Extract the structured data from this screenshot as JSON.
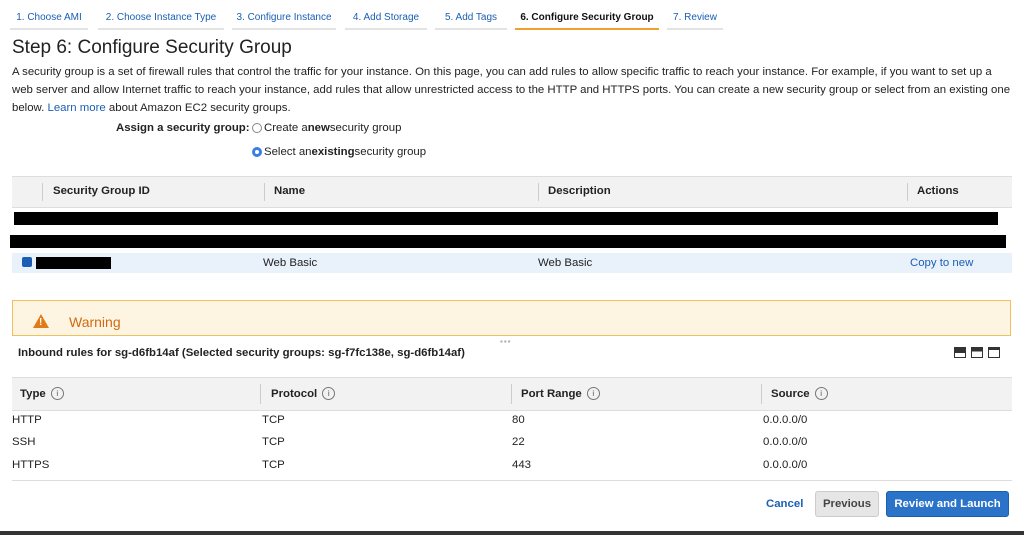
{
  "wizard_tabs": [
    {
      "label": "1. Choose AMI",
      "active": false
    },
    {
      "label": "2. Choose Instance Type",
      "active": false
    },
    {
      "label": "3. Configure Instance",
      "active": false
    },
    {
      "label": "4. Add Storage",
      "active": false
    },
    {
      "label": "5. Add Tags",
      "active": false
    },
    {
      "label": "6. Configure Security Group",
      "active": true
    },
    {
      "label": "7. Review",
      "active": false
    }
  ],
  "page": {
    "title": "Step 6: Configure Security Group",
    "intro_text": "A security group is a set of firewall rules that control the traffic for your instance. On this page, you can add rules to allow specific traffic to reach your instance. For example, if you want to set up a web server and allow Internet traffic to reach your instance, add rules that allow unrestricted access to the HTTP and HTTPS ports. You can create a new security group or select from an existing one below.",
    "learn_more": "Learn more",
    "intro_suffix": "about Amazon EC2 security groups."
  },
  "assign": {
    "label": "Assign a security group:",
    "option_new_pre": "Create a ",
    "option_new_bold": "new",
    "option_new_post": " security group",
    "option_existing_pre": "Select an ",
    "option_existing_bold": "existing",
    "option_existing_post": " security group",
    "selected": "existing"
  },
  "sg_table": {
    "headers": [
      "Security Group ID",
      "Name",
      "Description",
      "Actions"
    ],
    "selected_row": {
      "name": "Web Basic",
      "description": "Web Basic",
      "action": "Copy to new"
    }
  },
  "warning": {
    "title": "Warning"
  },
  "inbound": {
    "title": "Inbound rules for sg-d6fb14af (Selected security groups: sg-f7fc138e, sg-d6fb14af)"
  },
  "rules_table": {
    "headers": [
      "Type",
      "Protocol",
      "Port Range",
      "Source"
    ],
    "rows": [
      {
        "type": "HTTP",
        "protocol": "TCP",
        "port": "80",
        "source": "0.0.0.0/0"
      },
      {
        "type": "SSH",
        "protocol": "TCP",
        "port": "22",
        "source": "0.0.0.0/0"
      },
      {
        "type": "HTTPS",
        "protocol": "TCP",
        "port": "443",
        "source": "0.0.0.0/0"
      }
    ]
  },
  "buttons": {
    "cancel": "Cancel",
    "previous": "Previous",
    "review_launch": "Review and Launch"
  },
  "colors": {
    "link": "#1a5fb4",
    "active_tab": "#f0a030",
    "primary_button": "#2a73c9",
    "warning": "#e07b1a"
  }
}
